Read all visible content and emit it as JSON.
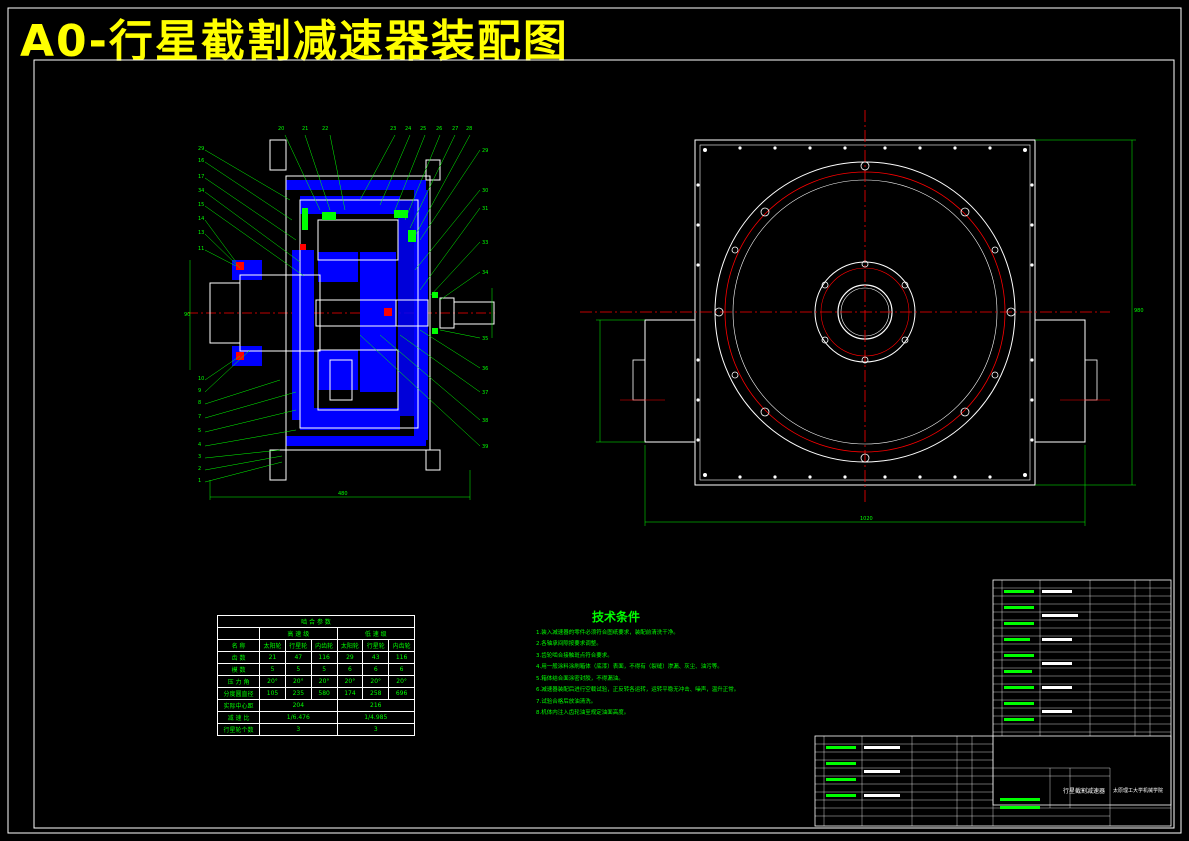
{
  "drawing": {
    "title": "A0-行星截割减速器装配图"
  },
  "technical_requirements": {
    "heading": "技术条件",
    "items": [
      "1.装入减速器的零件必须符合图纸要求，装配前清洗干净。",
      "2.各轴承间隙按要求调整。",
      "3.齿轮啮合接触斑点符合要求。",
      "4.用一般涂料涂刷箱体（底漆）表面，不得有（裂缝）渗漏、灰尘、油污等。",
      "5.箱体结合面涂密封胶，不得漏油。",
      "6.减速器装配后进行空载试验，正反转各运转，运转平稳无冲击、噪声，温升正常。",
      "7.试验合格后放油清洗。",
      "8.机体内注入齿轮油至规定油面高度。"
    ]
  },
  "meshing_params": {
    "title": "啮 合 参 数",
    "stage_headers": [
      "高 速 级",
      "低 速 级"
    ],
    "col_headers": [
      "名 称",
      "太阳轮",
      "行星轮",
      "内齿轮",
      "太阳轮",
      "行星轮",
      "内齿轮"
    ],
    "rows": [
      {
        "label": "齿 数",
        "values": [
          "21",
          "47",
          "116",
          "29",
          "43",
          "116"
        ]
      },
      {
        "label": "模 数",
        "values": [
          "5",
          "5",
          "5",
          "6",
          "6",
          "6"
        ]
      },
      {
        "label": "压 力 角",
        "values": [
          "20°",
          "20°",
          "20°",
          "20°",
          "20°",
          "20°"
        ]
      },
      {
        "label": "分度圆直径",
        "values": [
          "105",
          "235",
          "580",
          "174",
          "258",
          "696"
        ]
      }
    ],
    "merged_rows": [
      {
        "label": "实际中心距",
        "values": [
          "204",
          "216"
        ]
      },
      {
        "label": "减 速 比",
        "values": [
          "1/6.476",
          "1/4.985"
        ]
      },
      {
        "label": "行星轮个数",
        "values": [
          "3",
          "3"
        ]
      }
    ]
  },
  "title_block": {
    "drawing_name": "行星截割减速器",
    "organization": "太原理工大学机械学院"
  }
}
